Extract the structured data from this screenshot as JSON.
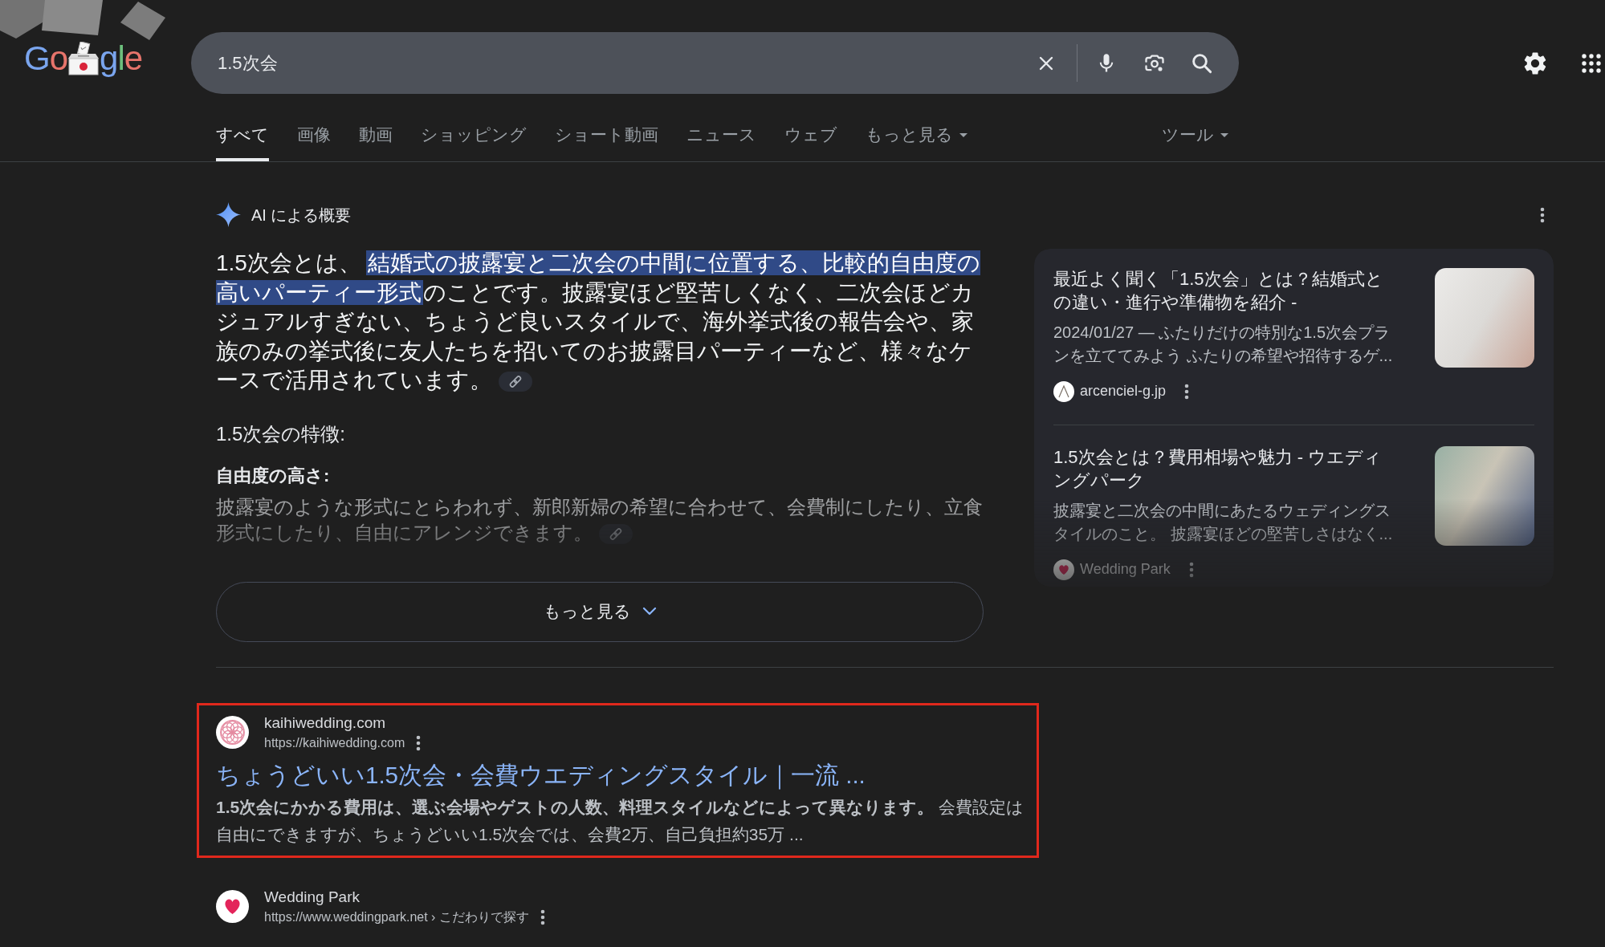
{
  "header": {
    "logo": [
      "Go",
      "gle"
    ],
    "search": {
      "value": "1.5次会"
    }
  },
  "tabs": [
    {
      "label": "すべて",
      "selected": true,
      "kind": "tab"
    },
    {
      "label": "画像",
      "selected": false,
      "kind": "tab"
    },
    {
      "label": "動画",
      "selected": false,
      "kind": "tab"
    },
    {
      "label": "ショッピング",
      "selected": false,
      "kind": "tab"
    },
    {
      "label": "ショート動画",
      "selected": false,
      "kind": "tab"
    },
    {
      "label": "ニュース",
      "selected": false,
      "kind": "tab"
    },
    {
      "label": "ウェブ",
      "selected": false,
      "kind": "tab"
    },
    {
      "label": "もっと見る",
      "selected": false,
      "kind": "menu"
    }
  ],
  "tools": {
    "label": "ツール"
  },
  "ai_overview": {
    "title": "AI による概要",
    "expanded": false,
    "summary": [
      {
        "text": "1.5次会とは、",
        "highlighted": false
      },
      {
        "text": "結婚式の披露宴と二次会の中間に位置する、比較的自由度の高いパーティー形式",
        "highlighted": true
      },
      {
        "text": "のことです。披露宴ほど堅苦しくなく、二次会ほどカジュアルすぎない、ちょうど良いスタイルで、海外挙式後の報告会や、家族のみの挙式後に友人たちを招いてのお披露目パーティーなど、様々なケースで活用されています。",
        "highlighted": false
      }
    ],
    "features_heading": "1.5次会の特徴:",
    "features": [
      {
        "title": "自由度の高さ:",
        "text": "披露宴のような形式にとらわれず、新郎新婦の希望に合わせて、会費制にしたり、立食形式にしたり、自由にアレンジできます。"
      }
    ],
    "more_button": "もっと見る",
    "sources": [
      {
        "title": "最近よく聞く「1.5次会」とは？結婚式との違い・進行や準備物を紹介 -",
        "snippet": "2024/01/27 — ふたりだけの特別な1.5次会プランを立ててみよう ふたりの希望や招待するゲ...",
        "site": "arcenciel-g.jp"
      },
      {
        "title": "1.5次会とは？費用相場や魅力 - ウエディングパーク",
        "snippet": "披露宴と二次会の中間にあたるウェディングスタイルのこと。 披露宴ほどの堅苦しさはなく...",
        "site": "Wedding Park"
      }
    ]
  },
  "results": [
    {
      "site": "kaihiwedding.com",
      "url": "https://kaihiwedding.com",
      "title": "ちょうどいい1.5次会・会費ウエディングスタイル｜一流 ...",
      "snippet": "**1.5次会にかかる費用は、選ぶ会場やゲストの人数、料理スタイルなどによって異なります。** 会費設定は自由にできますが、ちょうどいい1.5次会では、会費2万、自己負担約35万 ...",
      "framed": true
    },
    {
      "site": "Wedding Park",
      "url": "https://www.weddingpark.net › こだわりで探す",
      "framed": false
    }
  ]
}
